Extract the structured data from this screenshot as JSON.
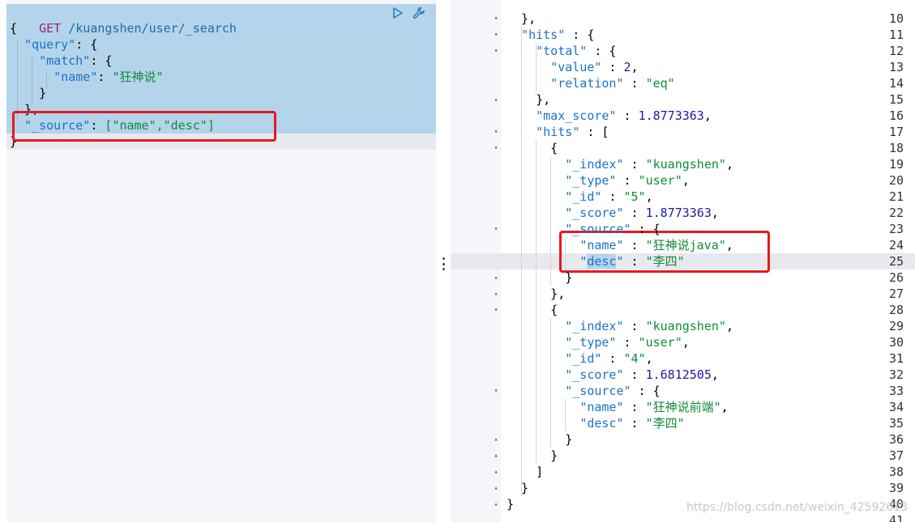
{
  "request": {
    "method": "GET",
    "path": "/kuangshen/user/_search",
    "brace_open": "{",
    "brace_close": "}",
    "query_key": "\"query\"",
    "match_key": "\"match\"",
    "name_key": "\"name\"",
    "name_value": "\"狂神说\"",
    "source_key": "\"_source\"",
    "source_value": "[\"name\",\"desc\"]"
  },
  "toolbar": {
    "run_icon": "play-icon",
    "settings_icon": "wrench-icon"
  },
  "response": {
    "lines": [
      {
        "num": "10",
        "fold": "▾",
        "text": "  },"
      },
      {
        "num": "11",
        "fold": "▾",
        "text": "  \"hits\" : {"
      },
      {
        "num": "12",
        "fold": "▾",
        "text": "    \"total\" : {"
      },
      {
        "num": "13",
        "fold": "",
        "text": "      \"value\" : 2,"
      },
      {
        "num": "14",
        "fold": "",
        "text": "      \"relation\" : \"eq\""
      },
      {
        "num": "15",
        "fold": "▴",
        "text": "    },"
      },
      {
        "num": "16",
        "fold": "",
        "text": "    \"max_score\" : 1.8773363,"
      },
      {
        "num": "17",
        "fold": "▾",
        "text": "    \"hits\" : ["
      },
      {
        "num": "18",
        "fold": "▾",
        "text": "      {"
      },
      {
        "num": "19",
        "fold": "",
        "text": "        \"_index\" : \"kuangshen\","
      },
      {
        "num": "20",
        "fold": "",
        "text": "        \"_type\" : \"user\","
      },
      {
        "num": "21",
        "fold": "",
        "text": "        \"_id\" : \"5\","
      },
      {
        "num": "22",
        "fold": "",
        "text": "        \"_score\" : 1.8773363,"
      },
      {
        "num": "23",
        "fold": "▾",
        "text": "        \"_source\" : {"
      },
      {
        "num": "24",
        "fold": "",
        "text": "          \"name\" : \"狂神说java\","
      },
      {
        "num": "25",
        "fold": "",
        "text": "          \"desc\" : \"李四\""
      },
      {
        "num": "26",
        "fold": "▴",
        "text": "        }"
      },
      {
        "num": "27",
        "fold": "▴",
        "text": "      },"
      },
      {
        "num": "28",
        "fold": "▾",
        "text": "      {"
      },
      {
        "num": "29",
        "fold": "",
        "text": "        \"_index\" : \"kuangshen\","
      },
      {
        "num": "30",
        "fold": "",
        "text": "        \"_type\" : \"user\","
      },
      {
        "num": "31",
        "fold": "",
        "text": "        \"_id\" : \"4\","
      },
      {
        "num": "32",
        "fold": "",
        "text": "        \"_score\" : 1.6812505,"
      },
      {
        "num": "33",
        "fold": "▾",
        "text": "        \"_source\" : {"
      },
      {
        "num": "34",
        "fold": "",
        "text": "          \"name\" : \"狂神说前端\","
      },
      {
        "num": "35",
        "fold": "",
        "text": "          \"desc\" : \"李四\""
      },
      {
        "num": "36",
        "fold": "▴",
        "text": "        }"
      },
      {
        "num": "37",
        "fold": "▴",
        "text": "      }"
      },
      {
        "num": "38",
        "fold": "▴",
        "text": "    ]"
      },
      {
        "num": "39",
        "fold": "▴",
        "text": "  }"
      },
      {
        "num": "40",
        "fold": "▴",
        "text": "}"
      },
      {
        "num": "41",
        "fold": "",
        "text": ""
      }
    ]
  },
  "watermark": "https://blog.csdn.net/weixin_42592613",
  "colors": {
    "selection": "#b3d4ea",
    "highlight_box": "#e8191f",
    "key": "#1a73c9",
    "string": "#118c38",
    "number": "#1a1aa6"
  }
}
